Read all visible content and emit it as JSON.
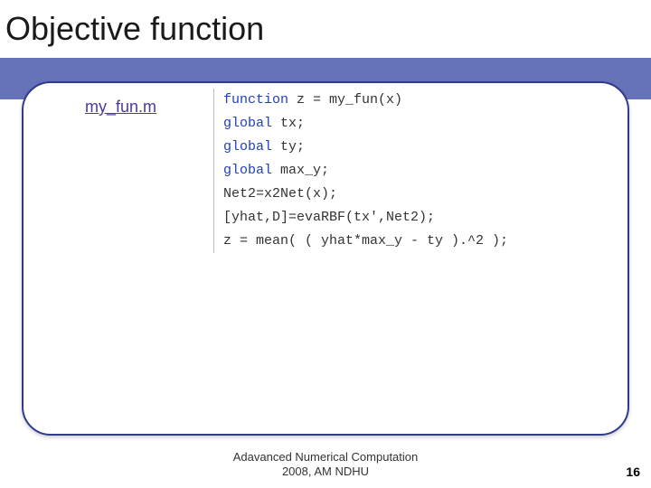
{
  "title": "Objective function",
  "link_label": "my_fun.m",
  "code_lines": [
    "function z = my_fun(x)",
    "global tx;",
    "global ty;",
    "global max_y;",
    "Net2=x2Net(x);",
    "[yhat,D]=evaRBF(tx',Net2);",
    "z = mean( ( yhat*max_y - ty ).^2 );"
  ],
  "footer_line1": "Adavanced Numerical Computation",
  "footer_line2": "2008, AM NDHU",
  "page_number": "16"
}
